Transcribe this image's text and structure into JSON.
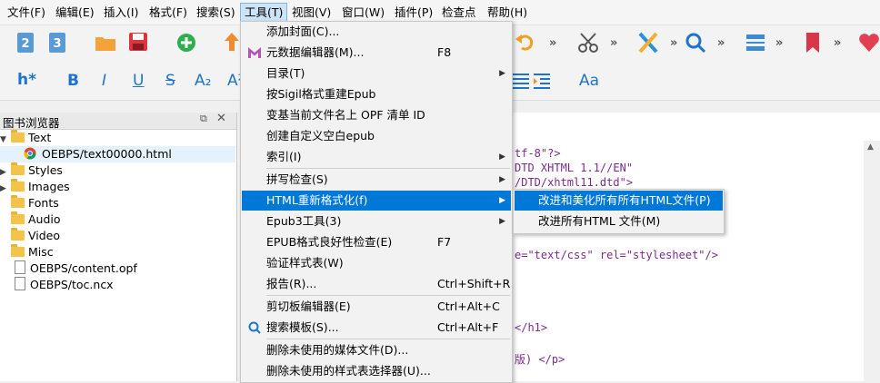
{
  "menubar": {
    "items": [
      {
        "label": "文件(F)"
      },
      {
        "label": "编辑(E)"
      },
      {
        "label": "插入(I)"
      },
      {
        "label": "格式(F)"
      },
      {
        "label": "搜索(S)"
      },
      {
        "label": "工具(T)"
      },
      {
        "label": "视图(V)"
      },
      {
        "label": "窗口(W)"
      },
      {
        "label": "插件(P)"
      },
      {
        "label": "检查点"
      },
      {
        "label": "帮助(H)"
      }
    ]
  },
  "toolbar": {
    "more": "»",
    "heading_label": "h*",
    "bold": "B",
    "italic": "I",
    "underline": "U",
    "strike": "S",
    "subscript": "A₂",
    "superscript": "A²",
    "case": "Aa"
  },
  "book_browser": {
    "title": "图书浏览器",
    "tree": [
      {
        "label": "Text"
      },
      {
        "label": "OEBPS/text00000.html"
      },
      {
        "label": "Styles"
      },
      {
        "label": "Images"
      },
      {
        "label": "Fonts"
      },
      {
        "label": "Audio"
      },
      {
        "label": "Video"
      },
      {
        "label": "Misc"
      },
      {
        "label": "OEBPS/content.opf"
      },
      {
        "label": "OEBPS/toc.ncx"
      }
    ]
  },
  "editor": {
    "lines": [
      "tf-8\"?>",
      "DTD XHTML 1.1//EN\"",
      "/DTD/xhtml11.dtd\">",
      "e=\"text/css\" rel=\"stylesheet\"/>",
      "</h1>",
      "版) </p>"
    ]
  },
  "tools_menu": {
    "items": [
      {
        "label": "添加封面(C)...",
        "shortcut": ""
      },
      {
        "label": "元数据编辑器(M)...",
        "shortcut": "F8"
      },
      {
        "label": "目录(T)",
        "shortcut": ""
      },
      {
        "label": "按Sigil格式重建Epub",
        "shortcut": ""
      },
      {
        "label": "变基当前文件名上 OPF 清单 ID",
        "shortcut": ""
      },
      {
        "label": "创建自定义空白epub",
        "shortcut": ""
      },
      {
        "label": "索引(I)",
        "shortcut": ""
      },
      {
        "label": "拼写检查(S)",
        "shortcut": ""
      },
      {
        "label": "HTML重新格式化(f)",
        "shortcut": ""
      },
      {
        "label": "Epub3工具(3)",
        "shortcut": ""
      },
      {
        "label": "EPUB格式良好性检查(E)",
        "shortcut": "F7"
      },
      {
        "label": "验证样式表(W)",
        "shortcut": ""
      },
      {
        "label": "报告(R)...",
        "shortcut": "Ctrl+Shift+R"
      },
      {
        "label": "剪切板编辑器(E)",
        "shortcut": "Ctrl+Alt+C"
      },
      {
        "label": "搜索模板(S)...",
        "shortcut": "Ctrl+Alt+F"
      },
      {
        "label": "删除未使用的媒体文件(D)...",
        "shortcut": ""
      },
      {
        "label": "删除未使用的样式表选择器(U)...",
        "shortcut": ""
      }
    ]
  },
  "reformat_submenu": {
    "items": [
      {
        "label": "改进和美化所有所有HTML文件(P)"
      },
      {
        "label": "改进所有HTML 文件(M)"
      }
    ]
  },
  "colors": {
    "highlight": "#0078d7",
    "accent": "#1e74c9",
    "menu_bg": "#f2f2f2"
  }
}
